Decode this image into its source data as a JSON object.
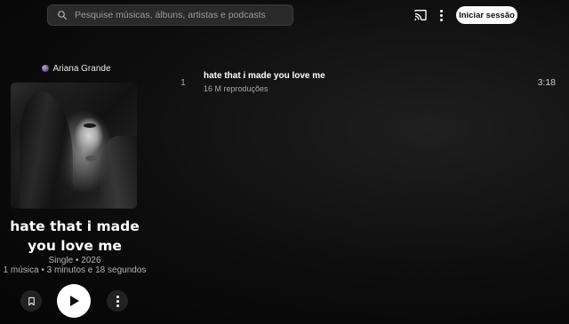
{
  "search": {
    "placeholder": "Pesquise músicas, álbuns, artistas e podcasts"
  },
  "header": {
    "signin_label": "Iniciar sessão"
  },
  "album": {
    "artist": "Ariana Grande",
    "title": "hate that i made you love me",
    "type_year": "Single • 2026",
    "summary": "1 música • 3 minutos e 18 segundos"
  },
  "tracks": [
    {
      "number": "1",
      "title": "hate that i made you love me",
      "plays": "16 M reproduções",
      "duration": "3:18"
    }
  ],
  "icons": {
    "search": "search-icon",
    "cast": "cast-icon",
    "more": "more-vert-icon",
    "save": "bookmark-icon",
    "play": "play-icon"
  }
}
